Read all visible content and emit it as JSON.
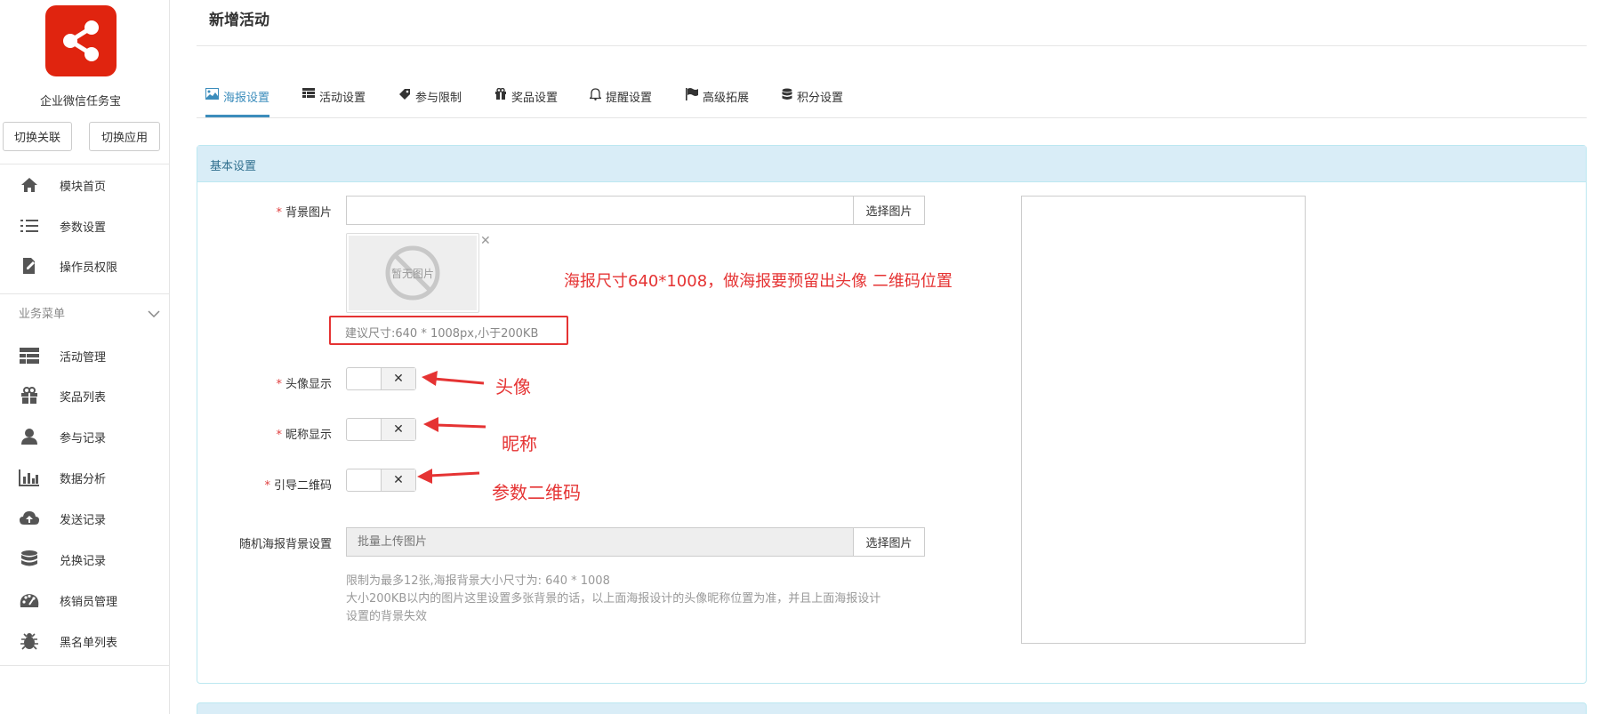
{
  "app": {
    "name": "企业微信任务宝",
    "brand_color": "#e0240f"
  },
  "sidebar": {
    "switch_buttons": [
      "切换关联",
      "切换应用"
    ],
    "top_items": [
      {
        "label": "模块首页",
        "icon": "home-icon"
      },
      {
        "label": "参数设置",
        "icon": "list-icon"
      },
      {
        "label": "操作员权限",
        "icon": "edit-file-icon"
      }
    ],
    "section_label": "业务菜单",
    "business_items": [
      {
        "label": "活动管理",
        "icon": "table-icon"
      },
      {
        "label": "奖品列表",
        "icon": "gift-icon"
      },
      {
        "label": "参与记录",
        "icon": "user-icon"
      },
      {
        "label": "数据分析",
        "icon": "bar-chart-icon"
      },
      {
        "label": "发送记录",
        "icon": "cloud-upload-icon"
      },
      {
        "label": "兑换记录",
        "icon": "database-icon"
      },
      {
        "label": "核销员管理",
        "icon": "dashboard-icon"
      },
      {
        "label": "黑名单列表",
        "icon": "bug-icon"
      }
    ]
  },
  "page": {
    "title": "新增活动"
  },
  "tabs": [
    {
      "label": "海报设置",
      "icon": "image-icon",
      "active": true
    },
    {
      "label": "活动设置",
      "icon": "table-icon",
      "active": false
    },
    {
      "label": "参与限制",
      "icon": "tag-icon",
      "active": false
    },
    {
      "label": "奖品设置",
      "icon": "gift-icon",
      "active": false
    },
    {
      "label": "提醒设置",
      "icon": "bell-icon",
      "active": false
    },
    {
      "label": "高级拓展",
      "icon": "flag-icon",
      "active": false
    },
    {
      "label": "积分设置",
      "icon": "database-icon",
      "active": false
    }
  ],
  "panel": {
    "title": "基本设置"
  },
  "form": {
    "bg_image": {
      "label": "背景图片",
      "value": "",
      "button": "选择图片",
      "placeholder_image_text": "暂无图片",
      "hint": "建议尺寸:640 * 1008px,小于200KB"
    },
    "avatar_display": {
      "label": "头像显示",
      "toggle_symbol": "✕"
    },
    "nickname_display": {
      "label": "昵称显示",
      "toggle_symbol": "✕"
    },
    "guide_qrcode": {
      "label": "引导二维码",
      "toggle_symbol": "✕"
    },
    "random_bg": {
      "label": "随机海报背景设置",
      "placeholder": "批量上传图片",
      "button": "选择图片",
      "help_lines": [
        "限制为最多12张,海报背景大小尺寸为: 640 * 1008",
        "大小200KB以内的图片这里设置多张背景的话，以上面海报设计的头像昵称位置为准，并且上面海报设计",
        "设置的背景失效"
      ]
    }
  },
  "annotations": {
    "poster_note": "海报尺寸640*1008，做海报要预留出头像  二维码位置",
    "avatar_note": "头像",
    "nickname_note": "昵称",
    "qrcode_note": "参数二维码",
    "color": "#e53333"
  },
  "required_mark": "*"
}
